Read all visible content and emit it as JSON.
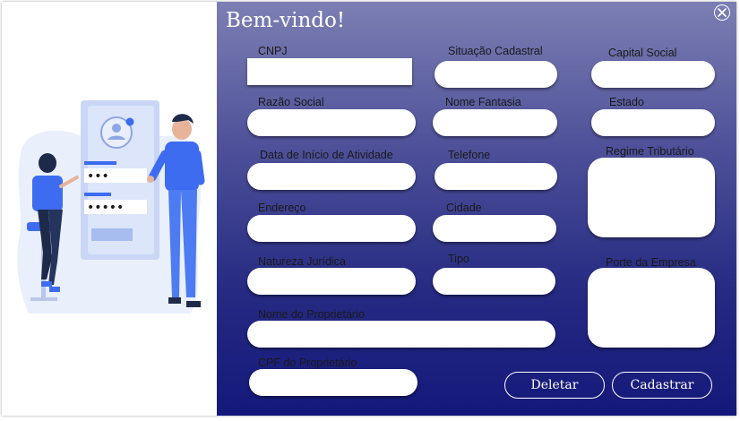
{
  "form": {
    "title": "Bem-vindo!",
    "close_icon": "close-icon",
    "fields": {
      "cnpj": "CNPJ",
      "situacao": "Situação Cadastral",
      "capital": "Capital Social",
      "razao": "Razão Social",
      "fantasia": "Nome Fantasia",
      "estado": "Estado",
      "data_inicio": "Data de Início de Atividade",
      "telefone": "Telefone",
      "regime": "Regime Tributário",
      "endereco": "Endereço",
      "cidade": "Cidade",
      "natureza": "Natureza Jurídica",
      "tipo": "Tipo",
      "porte": "Porte da Empresa",
      "proprietario": "Nome do Proprietário",
      "cpf": "CPF do Proprietário"
    },
    "buttons": {
      "delete": "Deletar",
      "submit": "Cadastrar"
    }
  },
  "illustration": {
    "password_dots_1": "•••",
    "password_dots_2": "•••••"
  },
  "colors": {
    "panel_top": "#7c7fb3",
    "panel_bottom": "#14187a",
    "accent_blue": "#3d6cf0"
  }
}
